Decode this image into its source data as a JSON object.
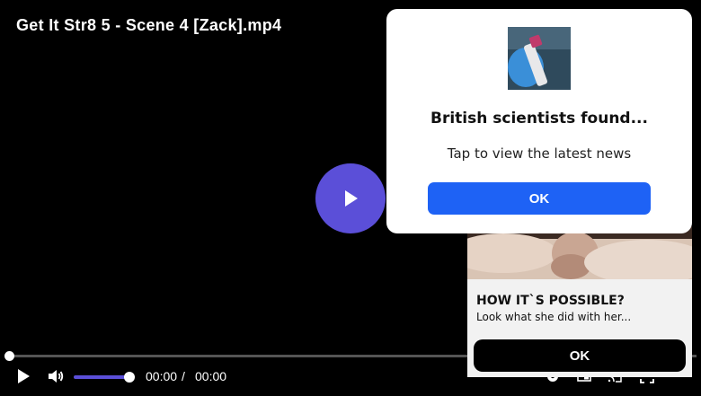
{
  "video": {
    "title": "Get It Str8 5 - Scene 4 [Zack].mp4",
    "progress": 0.0,
    "volume": 1.0,
    "current_time": "00:00",
    "separator": "/",
    "duration": "00:00",
    "accent_color": "#5b4fd8"
  },
  "controls": {
    "icons": [
      "play-icon",
      "volume-icon",
      "settings-icon",
      "picture-in-picture-icon",
      "cast-icon",
      "fullscreen-icon"
    ]
  },
  "popup": {
    "image_icon": "test-tube-photo",
    "headline": "British scientists found...",
    "subtext": "Tap to view the latest news",
    "ok_label": "OK",
    "button_color": "#1e62f5"
  },
  "ad": {
    "headline": "HOW IT`S POSSIBLE?",
    "text": "Look what she did with her...",
    "ok_label": "OK"
  }
}
